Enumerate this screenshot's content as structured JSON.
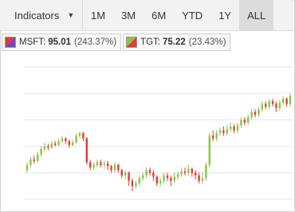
{
  "toolbar": {
    "indicators_label": "Indicators",
    "periods": [
      "1M",
      "3M",
      "6M",
      "YTD",
      "1Y",
      "ALL"
    ],
    "active_period": "ALL"
  },
  "legend": [
    {
      "symbol": "MSFT",
      "value": "95.01",
      "change": "(243.37%)",
      "color_up": "#e53935",
      "color_down": "#7b3fd1"
    },
    {
      "symbol": "TGT",
      "value": "75.22",
      "change": "(23.43%)",
      "color_up": "#8bc34a",
      "color_down": "#e53935"
    }
  ],
  "colors": {
    "up": "#8bc34a",
    "down": "#e53935",
    "grid": "#e6e6e6"
  },
  "chart_data": {
    "type": "candlestick",
    "title": "",
    "ylim": [
      0,
      100
    ],
    "grid": true,
    "series": [
      {
        "name": "MSFT",
        "candles": [
          {
            "o": 22,
            "c": 26,
            "h": 28,
            "l": 20
          },
          {
            "o": 26,
            "c": 30,
            "h": 32,
            "l": 24
          },
          {
            "o": 30,
            "c": 29,
            "h": 33,
            "l": 27
          },
          {
            "o": 29,
            "c": 34,
            "h": 36,
            "l": 28
          },
          {
            "o": 34,
            "c": 38,
            "h": 40,
            "l": 32
          },
          {
            "o": 38,
            "c": 40,
            "h": 43,
            "l": 36
          },
          {
            "o": 40,
            "c": 39,
            "h": 42,
            "l": 37
          },
          {
            "o": 39,
            "c": 42,
            "h": 44,
            "l": 38
          },
          {
            "o": 42,
            "c": 41,
            "h": 44,
            "l": 40
          },
          {
            "o": 41,
            "c": 44,
            "h": 46,
            "l": 40
          },
          {
            "o": 44,
            "c": 46,
            "h": 48,
            "l": 42
          },
          {
            "o": 46,
            "c": 44,
            "h": 47,
            "l": 42
          },
          {
            "o": 44,
            "c": 41,
            "h": 45,
            "l": 39
          },
          {
            "o": 41,
            "c": 43,
            "h": 45,
            "l": 40
          },
          {
            "o": 43,
            "c": 48,
            "h": 50,
            "l": 42
          },
          {
            "o": 48,
            "c": 50,
            "h": 51,
            "l": 46
          },
          {
            "o": 50,
            "c": 46,
            "h": 51,
            "l": 44
          },
          {
            "o": 46,
            "c": 28,
            "h": 47,
            "l": 26
          },
          {
            "o": 28,
            "c": 24,
            "h": 30,
            "l": 22
          },
          {
            "o": 24,
            "c": 26,
            "h": 28,
            "l": 22
          },
          {
            "o": 26,
            "c": 28,
            "h": 30,
            "l": 24
          },
          {
            "o": 28,
            "c": 26,
            "h": 30,
            "l": 24
          },
          {
            "o": 26,
            "c": 27,
            "h": 29,
            "l": 23
          },
          {
            "o": 27,
            "c": 25,
            "h": 29,
            "l": 22
          },
          {
            "o": 25,
            "c": 22,
            "h": 26,
            "l": 20
          },
          {
            "o": 22,
            "c": 26,
            "h": 28,
            "l": 20
          },
          {
            "o": 26,
            "c": 22,
            "h": 27,
            "l": 20
          },
          {
            "o": 22,
            "c": 18,
            "h": 23,
            "l": 16
          },
          {
            "o": 18,
            "c": 20,
            "h": 22,
            "l": 15
          },
          {
            "o": 20,
            "c": 14,
            "h": 21,
            "l": 10
          },
          {
            "o": 14,
            "c": 10,
            "h": 16,
            "l": 6
          },
          {
            "o": 10,
            "c": 12,
            "h": 14,
            "l": 8
          },
          {
            "o": 12,
            "c": 16,
            "h": 18,
            "l": 10
          },
          {
            "o": 16,
            "c": 18,
            "h": 20,
            "l": 14
          },
          {
            "o": 18,
            "c": 22,
            "h": 24,
            "l": 16
          },
          {
            "o": 22,
            "c": 20,
            "h": 24,
            "l": 18
          },
          {
            "o": 20,
            "c": 17,
            "h": 22,
            "l": 14
          },
          {
            "o": 17,
            "c": 12,
            "h": 18,
            "l": 10
          },
          {
            "o": 12,
            "c": 14,
            "h": 16,
            "l": 10
          },
          {
            "o": 14,
            "c": 18,
            "h": 20,
            "l": 12
          },
          {
            "o": 18,
            "c": 16,
            "h": 20,
            "l": 14
          },
          {
            "o": 16,
            "c": 14,
            "h": 18,
            "l": 10
          },
          {
            "o": 14,
            "c": 17,
            "h": 20,
            "l": 12
          },
          {
            "o": 17,
            "c": 19,
            "h": 21,
            "l": 15
          },
          {
            "o": 19,
            "c": 21,
            "h": 24,
            "l": 17
          },
          {
            "o": 21,
            "c": 20,
            "h": 24,
            "l": 18
          },
          {
            "o": 20,
            "c": 23,
            "h": 26,
            "l": 18
          },
          {
            "o": 23,
            "c": 20,
            "h": 24,
            "l": 17
          },
          {
            "o": 20,
            "c": 18,
            "h": 22,
            "l": 15
          },
          {
            "o": 18,
            "c": 14,
            "h": 20,
            "l": 12
          },
          {
            "o": 14,
            "c": 16,
            "h": 20,
            "l": 12
          },
          {
            "o": 16,
            "c": 26,
            "h": 28,
            "l": 14
          },
          {
            "o": 26,
            "c": 48,
            "h": 50,
            "l": 24
          },
          {
            "o": 48,
            "c": 46,
            "h": 52,
            "l": 44
          },
          {
            "o": 46,
            "c": 50,
            "h": 52,
            "l": 44
          },
          {
            "o": 50,
            "c": 52,
            "h": 54,
            "l": 48
          },
          {
            "o": 52,
            "c": 50,
            "h": 55,
            "l": 48
          },
          {
            "o": 50,
            "c": 53,
            "h": 56,
            "l": 48
          },
          {
            "o": 53,
            "c": 55,
            "h": 58,
            "l": 51
          },
          {
            "o": 55,
            "c": 52,
            "h": 57,
            "l": 50
          },
          {
            "o": 52,
            "c": 56,
            "h": 58,
            "l": 50
          },
          {
            "o": 56,
            "c": 60,
            "h": 62,
            "l": 54
          },
          {
            "o": 60,
            "c": 58,
            "h": 62,
            "l": 56
          },
          {
            "o": 58,
            "c": 62,
            "h": 64,
            "l": 56
          },
          {
            "o": 62,
            "c": 66,
            "h": 68,
            "l": 60
          },
          {
            "o": 66,
            "c": 64,
            "h": 68,
            "l": 62
          },
          {
            "o": 64,
            "c": 68,
            "h": 70,
            "l": 62
          },
          {
            "o": 68,
            "c": 72,
            "h": 74,
            "l": 66
          },
          {
            "o": 72,
            "c": 70,
            "h": 74,
            "l": 68
          },
          {
            "o": 70,
            "c": 74,
            "h": 76,
            "l": 68
          },
          {
            "o": 74,
            "c": 72,
            "h": 76,
            "l": 70
          },
          {
            "o": 72,
            "c": 69,
            "h": 74,
            "l": 66
          },
          {
            "o": 69,
            "c": 73,
            "h": 75,
            "l": 67
          },
          {
            "o": 73,
            "c": 76,
            "h": 78,
            "l": 71
          },
          {
            "o": 76,
            "c": 72,
            "h": 77,
            "l": 70
          },
          {
            "o": 72,
            "c": 78,
            "h": 80,
            "l": 70
          }
        ]
      }
    ]
  }
}
